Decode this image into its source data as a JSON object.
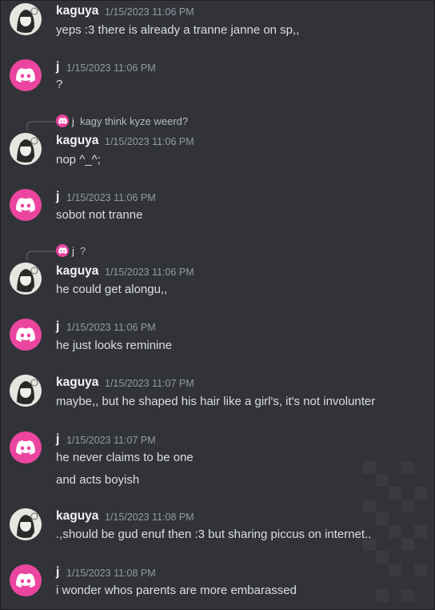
{
  "messages": [
    {
      "author": "kaguya",
      "timestamp": "1/15/2023 11:06 PM",
      "lines": [
        "yeps :3 there is already a tranne janne on sp,,"
      ]
    },
    {
      "author": "j",
      "timestamp": "1/15/2023 11:06 PM",
      "lines": [
        "?"
      ]
    },
    {
      "author": "kaguya",
      "timestamp": "1/15/2023 11:06 PM",
      "lines": [
        "nop ^_^;"
      ],
      "reply": {
        "author": "j",
        "text": "kagy think kyze weerd?"
      }
    },
    {
      "author": "j",
      "timestamp": "1/15/2023 11:06 PM",
      "lines": [
        "sobot not tranne"
      ]
    },
    {
      "author": "kaguya",
      "timestamp": "1/15/2023 11:06 PM",
      "lines": [
        "he could get alongu,,"
      ],
      "reply": {
        "author": "j",
        "text": "?"
      }
    },
    {
      "author": "j",
      "timestamp": "1/15/2023 11:06 PM",
      "lines": [
        "he just looks reminine"
      ]
    },
    {
      "author": "kaguya",
      "timestamp": "1/15/2023 11:07 PM",
      "lines": [
        "maybe,, but he shaped his hair like a girl's, it's not involunter"
      ]
    },
    {
      "author": "j",
      "timestamp": "1/15/2023 11:07 PM",
      "lines": [
        "he never claims to be one",
        "and acts boyish"
      ]
    },
    {
      "author": "kaguya",
      "timestamp": "1/15/2023 11:08 PM",
      "lines": [
        ".,should be gud enuf then :3 but sharing piccus on internet.."
      ]
    },
    {
      "author": "j",
      "timestamp": "1/15/2023 11:08 PM",
      "lines": [
        "i wonder whos parents are more embarassed"
      ]
    }
  ],
  "avatars": {
    "j": "discord-logo-icon",
    "kaguya": "anime-girl-avatar"
  },
  "colors": {
    "background": "#313338",
    "discord_pink": "#eb459f",
    "text": "#dbdee1",
    "muted": "#949ba4"
  }
}
